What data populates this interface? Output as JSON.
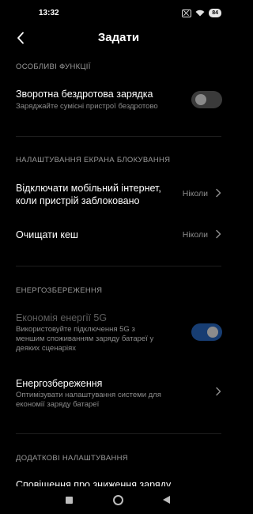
{
  "status_bar": {
    "time": "13:32",
    "battery": "84"
  },
  "header": {
    "title": "Задати"
  },
  "sections": {
    "special": "ОСОБЛИВІ ФУНКЦІЇ",
    "lockscreen": "НАЛАШТУВАННЯ ЕКРАНА БЛОКУВАННЯ",
    "power": "ЕНЕРГОЗБЕРЕЖЕННЯ",
    "additional": "ДОДАТКОВІ НАЛАШТУВАННЯ"
  },
  "items": {
    "reverse_charging": {
      "title": "Зворотна бездротова зарядка",
      "desc": "Заряджайте сумісні пристрої бездротово",
      "enabled": false
    },
    "disable_mobile_data": {
      "title_line1": "Відключати мобільний інтернет,",
      "title_line2": "коли пристрій заблоковано",
      "value": "Ніколи"
    },
    "clear_cache": {
      "title": "Очищати кеш",
      "value": "Ніколи"
    },
    "economy_5g": {
      "title": "Економія енергії 5G",
      "desc_line1": "Використовуйте підключення 5G з",
      "desc_line2": "меншим споживанням заряду батареї у",
      "desc_line3": "деяких сценаріях",
      "enabled": true
    },
    "battery_saver": {
      "title": "Енергозбереження",
      "desc_line1": "Оптимізувати налаштування системи для",
      "desc_line2": "економії заряду батареї"
    },
    "low_battery_cutoff": {
      "title": "Сповіщення про зниження заряду"
    }
  },
  "icons": {
    "back": "chevron-left-icon",
    "chevron": "chevron-right-icon",
    "nav_recents": "square-icon",
    "nav_home": "circle-icon",
    "nav_back": "triangle-icon"
  },
  "colors": {
    "accent": "#2a6fd0",
    "background": "#000000"
  }
}
